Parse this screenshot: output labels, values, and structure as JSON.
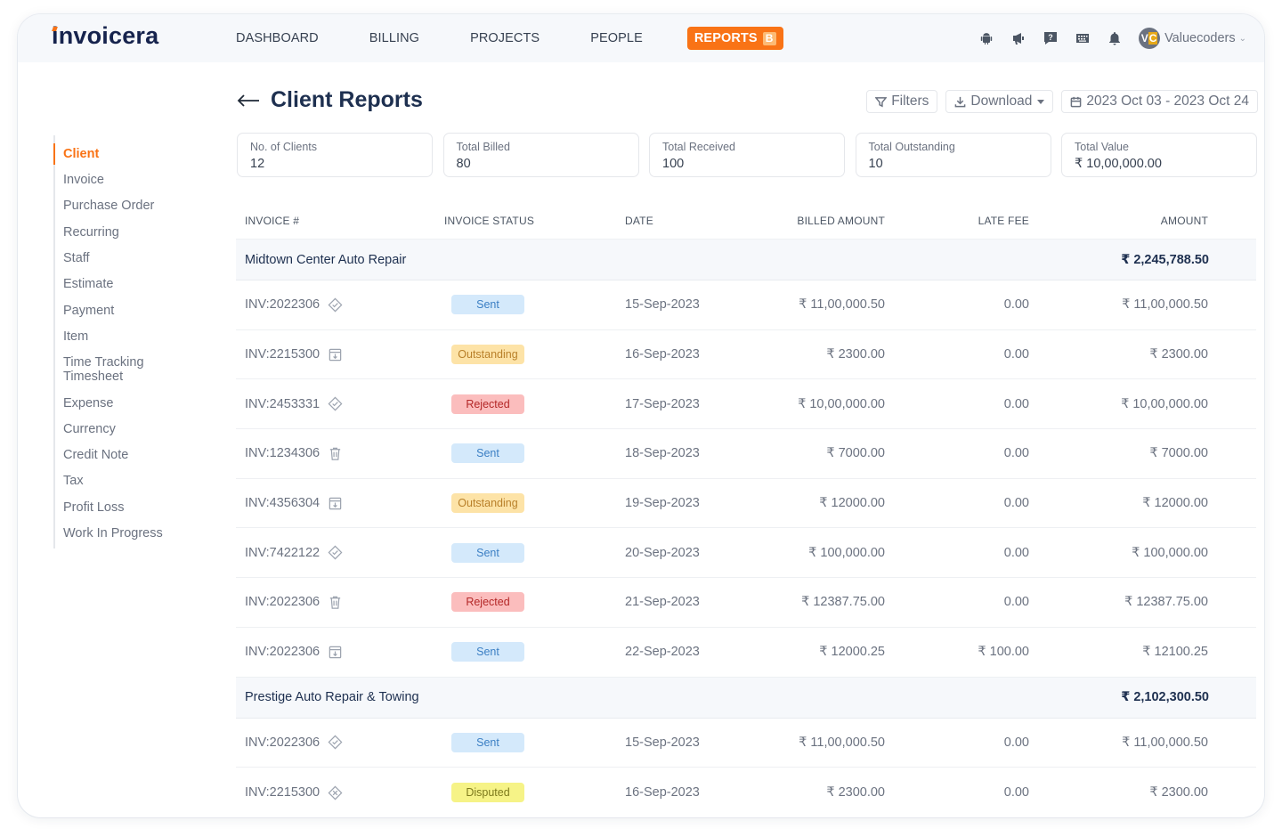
{
  "app": {
    "logo": "invoicera",
    "brand_color": "#f97316"
  },
  "nav": {
    "items": [
      {
        "label": "DASHBOARD",
        "active": false
      },
      {
        "label": "BILLING",
        "active": false
      },
      {
        "label": "PROJECTS",
        "active": false
      },
      {
        "label": "PEOPLE",
        "active": false
      },
      {
        "label": "REPORTS",
        "active": true,
        "badge": "B"
      }
    ],
    "icons": [
      "android-icon",
      "megaphone-icon",
      "help-icon",
      "keyboard-icon",
      "bell-icon"
    ],
    "user": {
      "initials": "VC",
      "name": "Valuecoders"
    }
  },
  "sidebar": {
    "items": [
      {
        "label": "Client",
        "active": true
      },
      {
        "label": "Invoice"
      },
      {
        "label": "Purchase Order"
      },
      {
        "label": "Recurring"
      },
      {
        "label": "Staff"
      },
      {
        "label": "Estimate"
      },
      {
        "label": "Payment"
      },
      {
        "label": "Item"
      },
      {
        "label": "Time Tracking\nTimesheet"
      },
      {
        "label": "Expense"
      },
      {
        "label": "Currency"
      },
      {
        "label": "Credit Note"
      },
      {
        "label": "Tax"
      },
      {
        "label": "Profit Loss"
      },
      {
        "label": "Work In Progress"
      }
    ]
  },
  "header": {
    "title": "Client Reports",
    "filters_label": "Filters",
    "download_label": "Download",
    "date_range": "2023 Oct 03 - 2023 Oct 24"
  },
  "stats": [
    {
      "label": "No. of Clients",
      "value": "12"
    },
    {
      "label": "Total Billed",
      "value": "80"
    },
    {
      "label": "Total Received",
      "value": "100"
    },
    {
      "label": "Total Outstanding",
      "value": "10"
    },
    {
      "label": "Total Value",
      "value": "₹ 10,00,000.00"
    }
  ],
  "table": {
    "columns": [
      "INVOICE #",
      "INVOICE STATUS",
      "DATE",
      "BILLED AMOUNT",
      "LATE FEE",
      "AMOUNT"
    ],
    "groups": [
      {
        "client": "Midtown Center Auto Repair",
        "total": "₹ 2,245,788.50",
        "rows": [
          {
            "invoice": "INV:2022306",
            "icon": "approved-icon",
            "status": "Sent",
            "date": "15-Sep-2023",
            "billed": "₹ 11,00,000.50",
            "late_fee": "0.00",
            "amount": "₹ 11,00,000.50"
          },
          {
            "invoice": "INV:2215300",
            "icon": "archive-icon",
            "status": "Outstanding",
            "date": "16-Sep-2023",
            "billed": "₹ 2300.00",
            "late_fee": "0.00",
            "amount": "₹ 2300.00"
          },
          {
            "invoice": "INV:2453331",
            "icon": "approved-icon",
            "status": "Rejected",
            "date": "17-Sep-2023",
            "billed": "₹ 10,00,000.00",
            "late_fee": "0.00",
            "amount": "₹ 10,00,000.00"
          },
          {
            "invoice": "INV:1234306",
            "icon": "trash-icon",
            "status": "Sent",
            "date": "18-Sep-2023",
            "billed": "₹ 7000.00",
            "late_fee": "0.00",
            "amount": "₹ 7000.00"
          },
          {
            "invoice": "INV:4356304",
            "icon": "archive-icon",
            "status": "Outstanding",
            "date": "19-Sep-2023",
            "billed": "₹ 12000.00",
            "late_fee": "0.00",
            "amount": "₹ 12000.00"
          },
          {
            "invoice": "INV:7422122",
            "icon": "approved-icon",
            "status": "Sent",
            "date": "20-Sep-2023",
            "billed": "₹ 100,000.00",
            "late_fee": "0.00",
            "amount": "₹ 100,000.00"
          },
          {
            "invoice": "INV:2022306",
            "icon": "trash-icon",
            "status": "Rejected",
            "date": "21-Sep-2023",
            "billed": "₹ 12387.75.00",
            "late_fee": "0.00",
            "amount": "₹ 12387.75.00"
          },
          {
            "invoice": "INV:2022306",
            "icon": "archive-icon",
            "status": "Sent",
            "date": "22-Sep-2023",
            "billed": "₹ 12000.25",
            "late_fee": "₹ 100.00",
            "amount": "₹ 12100.25"
          }
        ]
      },
      {
        "client": "Prestige Auto Repair & Towing",
        "total": "₹ 2,102,300.50",
        "rows": [
          {
            "invoice": "INV:2022306",
            "icon": "approved-icon",
            "status": "Sent",
            "date": "15-Sep-2023",
            "billed": "₹ 11,00,000.50",
            "late_fee": "0.00",
            "amount": "₹ 11,00,000.50"
          },
          {
            "invoice": "INV:2215300",
            "icon": "disputed-icon",
            "status": "Disputed",
            "date": "16-Sep-2023",
            "billed": "₹ 2300.00",
            "late_fee": "0.00",
            "amount": "₹ 2300.00"
          }
        ]
      }
    ]
  }
}
